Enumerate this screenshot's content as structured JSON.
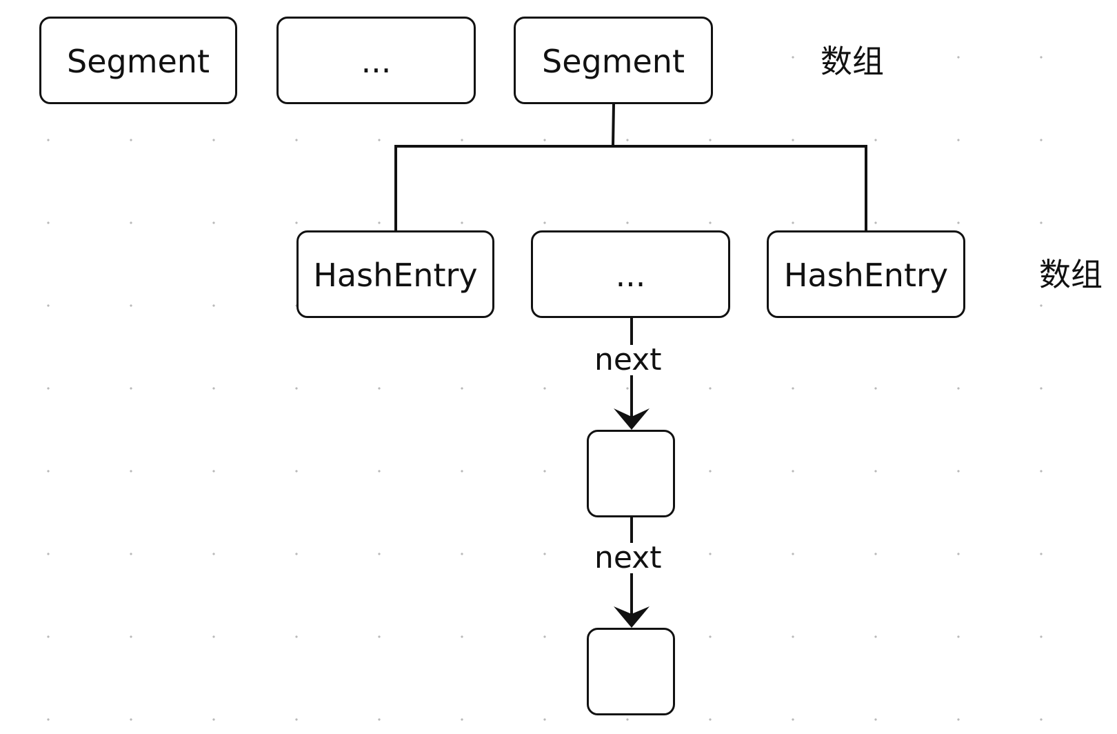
{
  "segment_array": {
    "items": [
      {
        "label": "Segment"
      },
      {
        "label": "..."
      },
      {
        "label": "Segment"
      }
    ],
    "array_label": "数组"
  },
  "hashentry_array": {
    "items": [
      {
        "label": "HashEntry"
      },
      {
        "label": "..."
      },
      {
        "label": "HashEntry"
      }
    ],
    "array_label": "数组"
  },
  "linked_list": {
    "next_labels": [
      "next",
      "next"
    ],
    "nodes": [
      {
        "label": ""
      },
      {
        "label": ""
      }
    ]
  },
  "colors": {
    "stroke": "#111111",
    "background": "#ffffff",
    "grid_dot": "#b9b9b9"
  }
}
